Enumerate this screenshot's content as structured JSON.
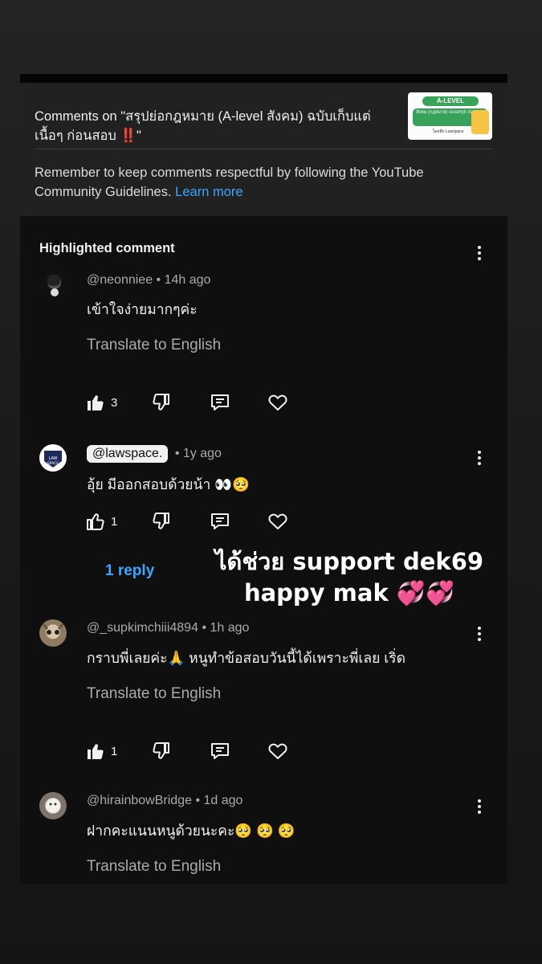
{
  "header": {
    "title": "Comments on \"สรุปย่อกฎหมาย (A-level สังคม)  ฉบับเก็บแต่เนื้อๆ ก่อนสอบ ‼️\"",
    "notice_text": "Remember to keep comments respectful by following the YouTube Community Guidelines.",
    "learn_more": "Learn more",
    "thumbnail": {
      "badge": "A-LEVEL",
      "box_text": "สังคม (กฎหมาย) แบบสรุป! ก่อนสอบ",
      "small_text": "โดยพี่ก Lawspace"
    }
  },
  "highlighted_label": "Highlighted comment",
  "comments": [
    {
      "author": "@neonniee",
      "time": "• 14h ago",
      "text": "เข้าใจง่ายมากๆค่ะ",
      "translate": "Translate to English",
      "likes": "3"
    },
    {
      "author": "@lawspace.",
      "time": "• 1y ago",
      "text": "อุ้ย มีออกสอบด้วยน้า 👀🥺",
      "likes": "1",
      "replies": "1 reply"
    },
    {
      "author": "@_supkimchiii4894",
      "time": "• 1h ago",
      "text": "กราบพี่เลยค่ะ🙏 หนูทำข้อสอบวันนี้ได้เพราะพี่เลย เริ่ด",
      "translate": "Translate to English",
      "likes": "1"
    },
    {
      "author": "@hirainbowBridge",
      "time": "• 1d ago",
      "text": "ฝากคะแนนหนูด้วยนะคะ🥺 🥺 🥺",
      "translate": "Translate to English"
    }
  ],
  "overlay": {
    "line1": "ได้ช่วย support dek69",
    "line2": "happy mak 💞💞"
  },
  "icons": {
    "like": "thumbs-up-icon",
    "dislike": "thumbs-down-icon",
    "reply": "reply-comment-icon",
    "heart": "heart-icon",
    "more": "more-vertical-icon"
  },
  "colors": {
    "link": "#3ea6ff",
    "background": "#0f0f0f",
    "header_bg": "#212121"
  }
}
